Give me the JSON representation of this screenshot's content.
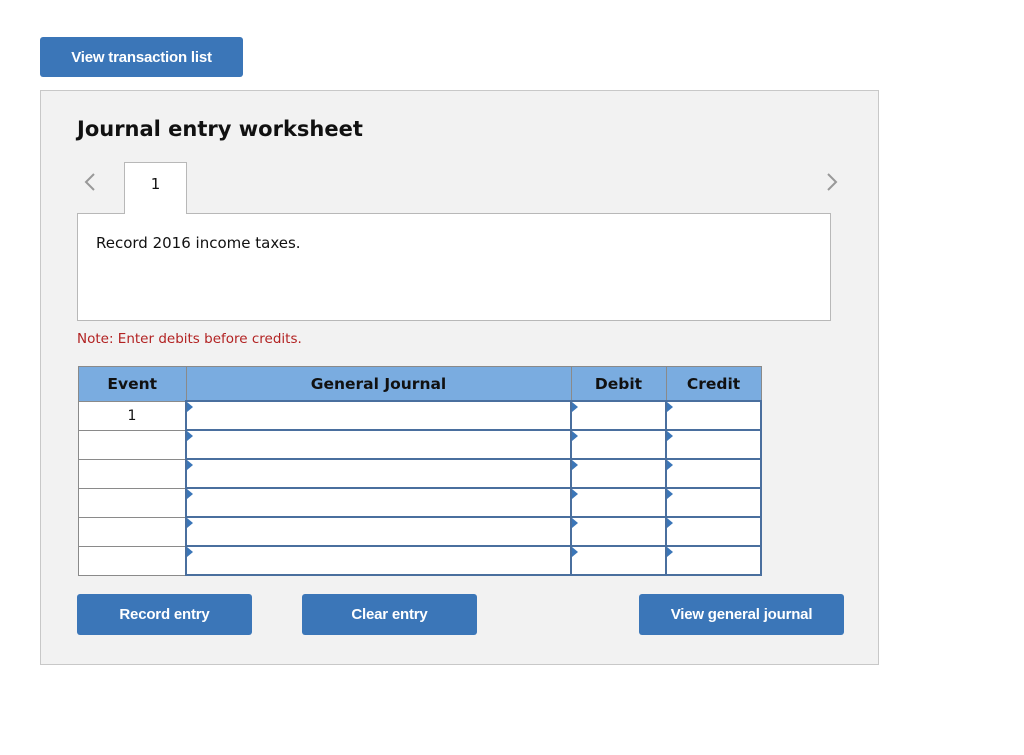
{
  "top_button": {
    "label": "View transaction list"
  },
  "worksheet": {
    "title": "Journal entry worksheet",
    "tabs": [
      {
        "label": "1",
        "active": true
      }
    ],
    "prev_icon": "chevron-left-icon",
    "next_icon": "chevron-right-icon",
    "description": "Record 2016 income taxes.",
    "note": "Note: Enter debits before credits."
  },
  "table": {
    "headers": {
      "event": "Event",
      "general_journal": "General Journal",
      "debit": "Debit",
      "credit": "Credit"
    },
    "rows": [
      {
        "event": "1",
        "account": "",
        "debit": "",
        "credit": ""
      },
      {
        "event": "",
        "account": "",
        "debit": "",
        "credit": ""
      },
      {
        "event": "",
        "account": "",
        "debit": "",
        "credit": ""
      },
      {
        "event": "",
        "account": "",
        "debit": "",
        "credit": ""
      },
      {
        "event": "",
        "account": "",
        "debit": "",
        "credit": ""
      },
      {
        "event": "",
        "account": "",
        "debit": "",
        "credit": ""
      }
    ]
  },
  "actions": {
    "record": "Record entry",
    "clear": "Clear entry",
    "view_journal": "View general journal"
  },
  "colors": {
    "button": "#3b76b8",
    "header": "#7aace0",
    "note": "#b22222",
    "panel": "#f2f2f2"
  }
}
